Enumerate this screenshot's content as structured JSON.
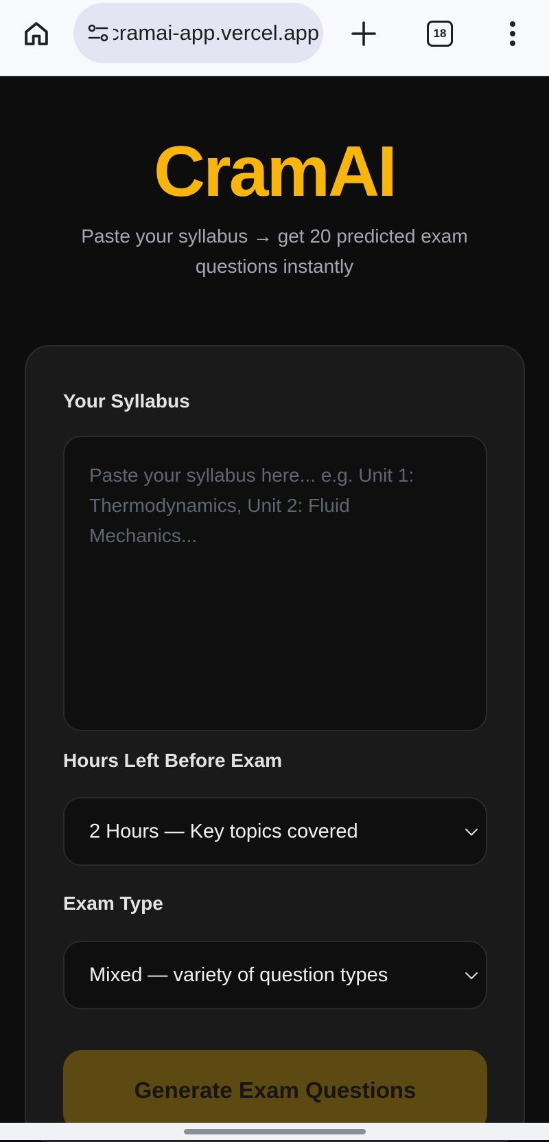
{
  "browser": {
    "url": "cramai-app.vercel.app",
    "tab_count": "18",
    "icons": [
      "home-icon",
      "site-settings-icon",
      "plus-icon",
      "tabs-icon",
      "more-vert-icon"
    ]
  },
  "hero": {
    "title": "CramAI",
    "tagline": "Paste your syllabus → get 20 predicted exam questions instantly"
  },
  "form": {
    "syllabus_label": "Your Syllabus",
    "syllabus_placeholder": "Paste your syllabus here... e.g. Unit 1: Thermodynamics, Unit 2: Fluid Mechanics...",
    "hours_label": "Hours Left Before Exam",
    "hours_value": "2 Hours — Key topics covered",
    "type_label": "Exam Type",
    "type_value": "Mixed — variety of question types",
    "submit_label": "Generate Exam Questions"
  },
  "colors": {
    "brand": "#f8b50b",
    "background": "#0d0d0d",
    "card": "#1a1a1a",
    "button_disabled": "#5d4912"
  }
}
